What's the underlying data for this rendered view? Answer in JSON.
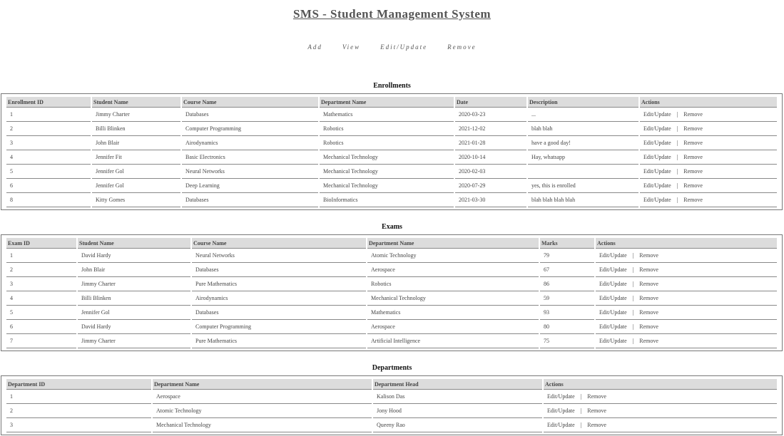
{
  "app": {
    "title": "SMS - Student Management System"
  },
  "nav": [
    "Add",
    "View",
    "Edit/Update",
    "Remove"
  ],
  "actions": {
    "edit": "Edit/Update",
    "sep": "|",
    "remove": "Remove"
  },
  "enrollments": {
    "title": "Enrollments",
    "columns": [
      "Enrollment ID",
      "Student Name",
      "Course Name",
      "Department Name",
      "Date",
      "Description",
      "Actions"
    ],
    "rows": [
      [
        "1",
        "Jimmy Charter",
        "Databases",
        "Mathematics",
        "2020-03-23",
        "..."
      ],
      [
        "2",
        "Billi Blinken",
        "Computer Programming",
        "Robotics",
        "2021-12-02",
        "blah blah"
      ],
      [
        "3",
        "John Blair",
        "Airodynamics",
        "Robotics",
        "2021-01-28",
        "have a good day!"
      ],
      [
        "4",
        "Jennifer Fit",
        "Basic Electronics",
        "Mechanical Technology",
        "2020-10-14",
        "Hay, whatsapp"
      ],
      [
        "5",
        "Jennifer Gol",
        "Neural Networks",
        "Mechanical Technology",
        "2020-02-03",
        ""
      ],
      [
        "6",
        "Jennifer Gol",
        "Deep Learning",
        "Mechanical Technology",
        "2020-07-29",
        "yes, this is enrolled"
      ],
      [
        "8",
        "Kitty Gomes",
        "Databases",
        "BioInformatics",
        "2021-03-30",
        "blah blah blah blah"
      ]
    ]
  },
  "exams": {
    "title": "Exams",
    "columns": [
      "Exam ID",
      "Student Name",
      "Course Name",
      "Department Name",
      "Marks",
      "Actions"
    ],
    "rows": [
      [
        "1",
        "David Hardy",
        "Neural Networks",
        "Atomic Technology",
        "79"
      ],
      [
        "2",
        "John Blair",
        "Databases",
        "Aerospace",
        "67"
      ],
      [
        "3",
        "Jimmy Charter",
        "Pure Mathematics",
        "Robotics",
        "86"
      ],
      [
        "4",
        "Billi Blinken",
        "Airodynamics",
        "Mechanical Technology",
        "59"
      ],
      [
        "5",
        "Jennifer Gol",
        "Databases",
        "Mathematics",
        "93"
      ],
      [
        "6",
        "David Hardy",
        "Computer Programming",
        "Aerospace",
        "80"
      ],
      [
        "7",
        "Jimmy Charter",
        "Pure Mathematics",
        "Artificial Intelligence",
        "75"
      ]
    ]
  },
  "departments": {
    "title": "Departments",
    "columns": [
      "Department ID",
      "Department Name",
      "Department Head",
      "Actions"
    ],
    "rows": [
      [
        "1",
        "Aerospace",
        "Kalison Das"
      ],
      [
        "2",
        "Atomic Technology",
        "Jony Hood"
      ],
      [
        "3",
        "Mechanical Technology",
        "Queeny Rao"
      ]
    ]
  }
}
